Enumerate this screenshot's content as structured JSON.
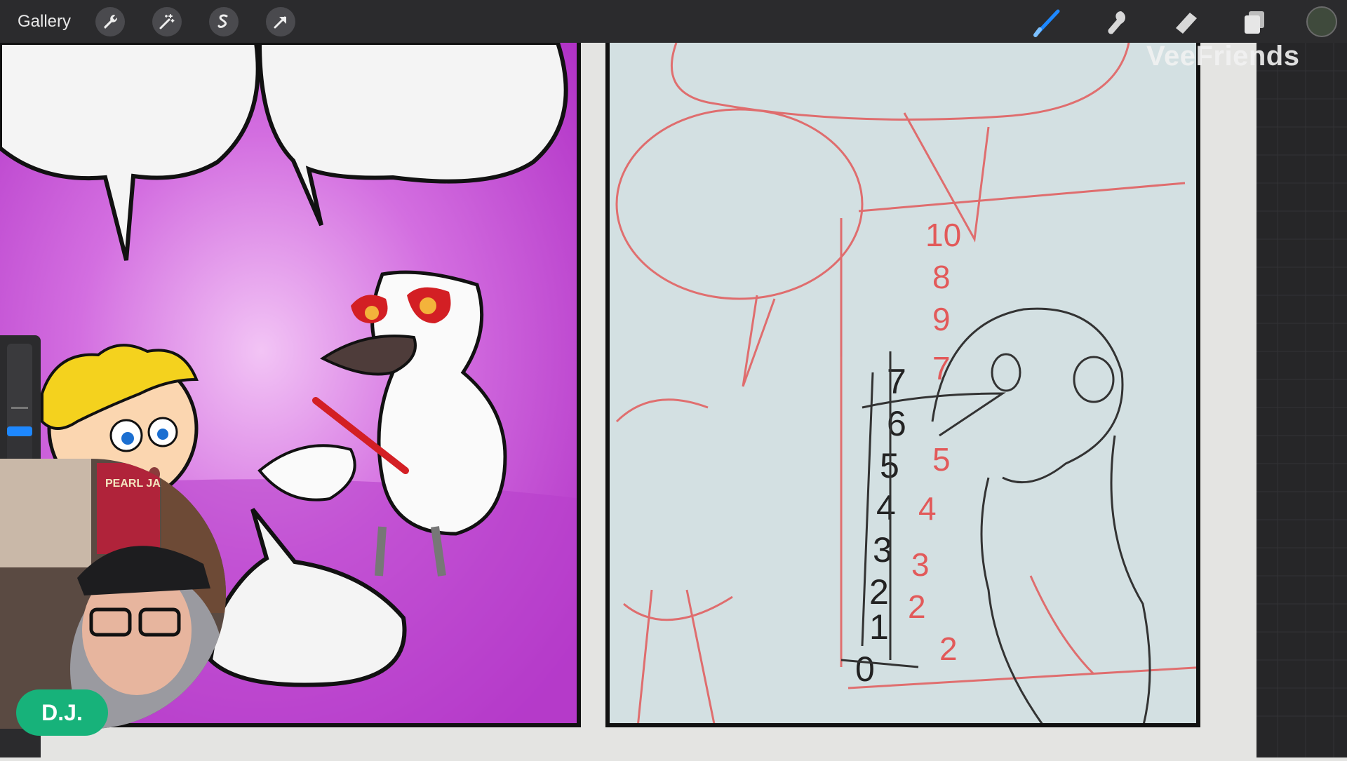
{
  "toolbar": {
    "gallery_label": "Gallery",
    "left_tools": [
      "wrench-icon",
      "magic-wand-icon",
      "selection-icon",
      "transform-arrow-icon"
    ],
    "right_tools": [
      "brush-icon",
      "smudge-icon",
      "eraser-icon",
      "layers-icon"
    ],
    "current_color": "#3f4a3c",
    "brush_accent": "#1e88ff"
  },
  "canvas": {
    "watermark": "VeeFriends",
    "sketch_numbers_left": [
      "7",
      "6",
      "5",
      "4",
      "3",
      "2",
      "1",
      "0"
    ],
    "sketch_numbers_right": [
      "10",
      "8",
      "9",
      "7",
      "5",
      "4",
      "3",
      "2",
      "2"
    ]
  },
  "webcam": {
    "poster_text": "PEARL JAM",
    "name_badge": "D.J."
  },
  "colors": {
    "panel_magenta": "#c14ad2",
    "sketch_red": "#e25a5a",
    "sketch_bg": "#d3e0e2",
    "badge_green": "#17b27a"
  }
}
